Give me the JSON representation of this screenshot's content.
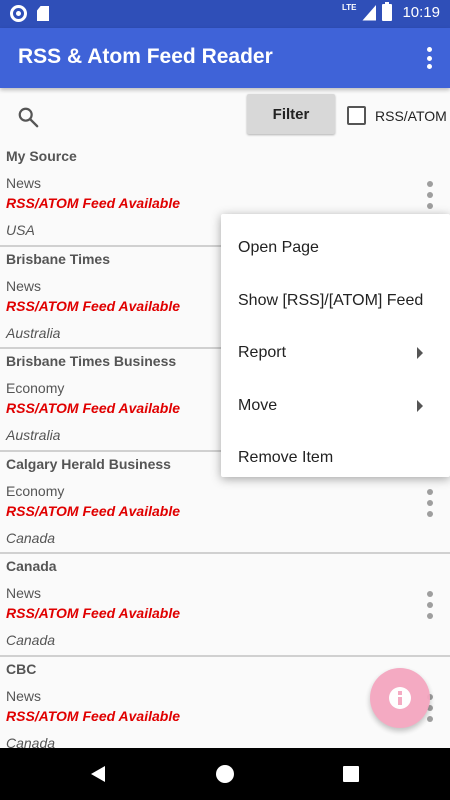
{
  "status_bar": {
    "network": "LTE",
    "time": "10:19",
    "left_icons": [
      "notification-circle-icon",
      "sd-card-icon"
    ],
    "right_icons": [
      "lte-signal-icon",
      "battery-icon"
    ]
  },
  "app_bar": {
    "title": "RSS & Atom Feed Reader",
    "menu_icon": "overflow-menu-icon"
  },
  "toolbar": {
    "search_icon": "search-icon",
    "filter_label": "Filter",
    "checkbox_label": "RSS/ATOM",
    "checkbox_checked": false
  },
  "feeds": [
    {
      "name": "My Source",
      "category": "News",
      "status": "RSS/ATOM Feed Available",
      "country": "USA"
    },
    {
      "name": "Brisbane Times",
      "category": "News",
      "status": "RSS/ATOM Feed Available",
      "country": "Australia"
    },
    {
      "name": "Brisbane Times Business",
      "category": "Economy",
      "status": "RSS/ATOM Feed Available",
      "country": "Australia"
    },
    {
      "name": "Calgary Herald Business",
      "category": "Economy",
      "status": "RSS/ATOM Feed Available",
      "country": "Canada"
    },
    {
      "name": "Canada",
      "category": "News",
      "status": "RSS/ATOM Feed Available",
      "country": "Canada"
    },
    {
      "name": "CBC",
      "category": "News",
      "status": "RSS/ATOM Feed Available",
      "country": "Canada"
    }
  ],
  "context_menu": {
    "items": [
      {
        "label": "Open Page",
        "submenu": false
      },
      {
        "label": "Show [RSS]/[ATOM] Feed",
        "submenu": false
      },
      {
        "label": "Report",
        "submenu": true
      },
      {
        "label": "Move",
        "submenu": true
      },
      {
        "label": "Remove Item",
        "submenu": false
      }
    ]
  },
  "fab": {
    "icon": "info-icon"
  },
  "colors": {
    "status_bar": "#2f4fb8",
    "app_bar": "#3f63d8",
    "feed_status": "#e00000",
    "fab": "#f4a6c0"
  },
  "nav_bar": {
    "icons": [
      "back-icon",
      "home-icon",
      "recents-icon"
    ]
  }
}
